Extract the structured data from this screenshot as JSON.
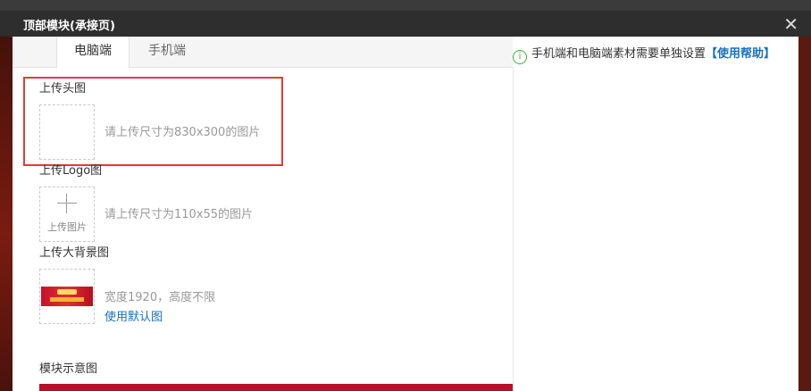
{
  "window": {
    "title": "顶部模块(承接页)",
    "close_label": "✕"
  },
  "tabs": [
    {
      "label": "电脑端"
    },
    {
      "label": "手机端"
    }
  ],
  "notice": {
    "icon": "info-icon",
    "text": "手机端和电脑端素材需要单独设置",
    "help_link": "【使用帮助】"
  },
  "sections": {
    "header_image": {
      "label": "上传头图",
      "hint": "请上传尺寸为830x300的图片"
    },
    "logo": {
      "label": "上传Logo图",
      "upload_label": "上传图片",
      "hint": "请上传尺寸为110x55的图片"
    },
    "background": {
      "label": "上传大背景图",
      "hint": "宽度1920，高度不限",
      "default_link": "使用默认图"
    },
    "preview": {
      "label": "模块示意图"
    }
  },
  "colors": {
    "highlight": "#e53935",
    "link": "#1a6fb8",
    "title_bar": "#2e2e2e"
  }
}
